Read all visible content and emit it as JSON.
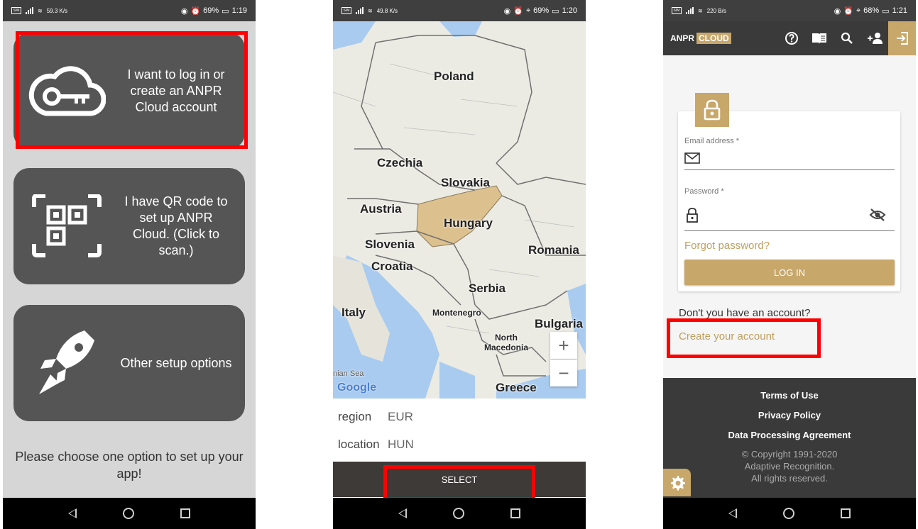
{
  "screens": [
    {
      "status": {
        "data_speed": "59.3 K/s",
        "battery": "69%",
        "time": "1:19"
      },
      "options": [
        {
          "label": "I want to log in or create an ANPR Cloud account",
          "icon": "cloud-key-icon"
        },
        {
          "label": "I have QR code to set up ANPR Cloud. (Click to scan.)",
          "icon": "qr-code-icon"
        },
        {
          "label": "Other setup options",
          "icon": "rocket-icon"
        }
      ],
      "footer_text": "Please choose one option to set up your app!"
    },
    {
      "status": {
        "data_speed": "49.8 K/s",
        "battery": "69%",
        "time": "1:20"
      },
      "map_labels": {
        "poland": "Poland",
        "czechia": "Czechia",
        "slovakia": "Slovakia",
        "austria": "Austria",
        "hungary": "Hungary",
        "slovenia": "Slovenia",
        "croatia": "Croatia",
        "romania": "Romania",
        "serbia": "Serbia",
        "italy": "Italy",
        "montenegro": "Montenegro",
        "bulgaria": "Bulgaria",
        "north_macedonia": "North Macedonia",
        "greece": "Greece",
        "sea": "nian Sea",
        "google": "Google"
      },
      "region_label": "region",
      "region_value": "EUR",
      "location_label": "location",
      "location_value": "HUN",
      "select_label": "SELECT",
      "zoom_in": "+",
      "zoom_out": "−"
    },
    {
      "status": {
        "data_speed": "220 B/s",
        "battery": "68%",
        "time": "1:21"
      },
      "logo": {
        "anpr": "ANPR",
        "cloud": "CLOUD"
      },
      "email_label": "Email address *",
      "password_label": "Password *",
      "forgot_password": "Forgot password?",
      "login_button": "LOG IN",
      "no_account": "Don't you have an account?",
      "create_account": "Create your account",
      "links": [
        "Terms of Use",
        "Privacy Policy",
        "Data Processing Agreement"
      ],
      "copyright": [
        "© Copyright 1991-2020",
        "Adaptive Recognition.",
        "All rights reserved."
      ]
    }
  ],
  "colors": {
    "accent": "#c8a76a",
    "highlight": "#ff0000",
    "dark": "#3a3a3a",
    "card": "#555555"
  }
}
